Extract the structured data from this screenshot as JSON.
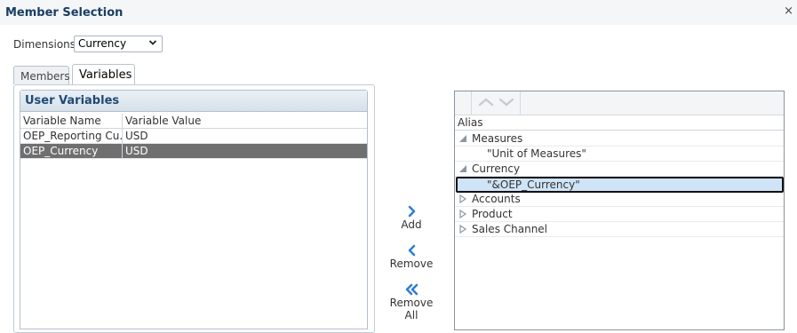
{
  "dialog": {
    "title": "Member Selection",
    "close_glyph": "×"
  },
  "dimensions": {
    "label": "Dimensions",
    "selected": "Currency"
  },
  "tabs": [
    {
      "label": "Members",
      "active": false
    },
    {
      "label": "Variables",
      "active": true
    }
  ],
  "user_variables": {
    "title": "User Variables",
    "columns": [
      "Variable Name",
      "Variable Value"
    ],
    "rows": [
      {
        "name": "OEP_Reporting Cu...",
        "value": "USD",
        "selected": false
      },
      {
        "name": "OEP_Currency",
        "value": "USD",
        "selected": true
      }
    ]
  },
  "shuttle": {
    "add": "Add",
    "remove": "Remove",
    "remove_all": "Remove All"
  },
  "selection_tree": {
    "column": "Alias",
    "items": [
      {
        "label": "Measures",
        "expander": "expanded",
        "level": 0
      },
      {
        "label": "\"Unit of Measures\"",
        "expander": "none",
        "level": 1
      },
      {
        "label": "Currency",
        "expander": "expanded",
        "level": 0
      },
      {
        "label": "\"&OEP_Currency\"",
        "expander": "none",
        "level": 1,
        "selected": true
      },
      {
        "label": "Accounts",
        "expander": "collapsed",
        "level": 0
      },
      {
        "label": "Product",
        "expander": "collapsed",
        "level": 0
      },
      {
        "label": "Sales Channel",
        "expander": "collapsed",
        "level": 0
      }
    ]
  },
  "icons": {
    "close": "close-icon",
    "dropdown": "chevron-down-icon",
    "move_up": "chevron-up-icon",
    "move_down": "chevron-down-icon",
    "add": "chevron-right-icon",
    "remove": "chevron-left-icon",
    "remove_all": "double-chevron-left-icon"
  },
  "colors": {
    "title": "#1a3e63",
    "accent_blue": "#2f7fd1",
    "selected_row": "#6f6f6f",
    "selected_tree": "#cfe4f6"
  }
}
